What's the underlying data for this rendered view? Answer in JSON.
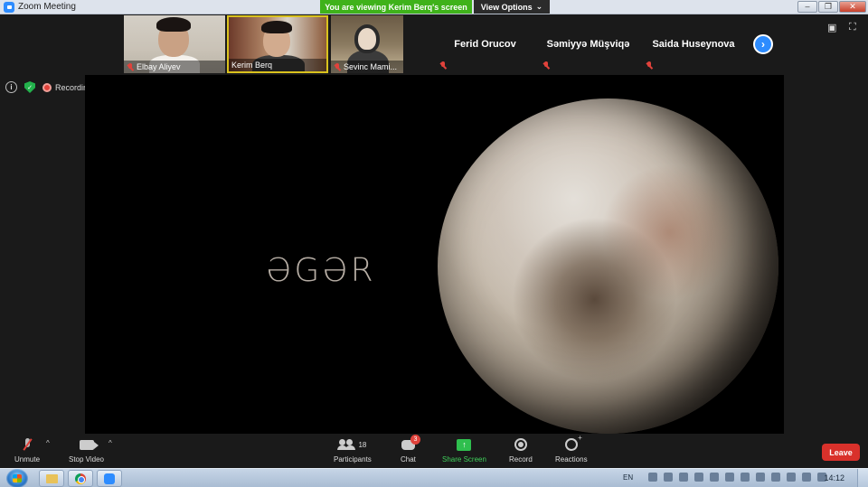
{
  "window": {
    "title": "Zoom Meeting",
    "viewing_banner": "You are viewing Kerim Berq's screen",
    "view_options_label": "View Options",
    "controls": [
      "–",
      "❐",
      "✕"
    ]
  },
  "participants_strip": {
    "video_tiles": [
      {
        "name": "Elbay Aliyev",
        "muted": true
      },
      {
        "name": "Kerim Berq",
        "muted": false
      },
      {
        "name": "Sevinc Mami...",
        "muted": true
      }
    ],
    "name_tiles": [
      {
        "name": "Ferid Orucov",
        "muted": true
      },
      {
        "name": "Səmiyyə Müşviqə",
        "muted": true
      },
      {
        "name": "Saida Huseynova",
        "muted": true
      }
    ],
    "next_arrow": "›"
  },
  "meeting_info": {
    "recording_label": "Recording"
  },
  "shared_screen": {
    "logo_text": "ƏGƏR"
  },
  "toolbar": {
    "unmute_label": "Unmute",
    "stop_video_label": "Stop Video",
    "participants_label": "Participants",
    "participants_count": "18",
    "chat_label": "Chat",
    "chat_badge": "3",
    "share_screen_label": "Share Screen",
    "record_label": "Record",
    "reactions_label": "Reactions",
    "leave_label": "Leave"
  },
  "taskbar": {
    "language": "EN",
    "clock": "14:12"
  },
  "colors": {
    "zoom_blue": "#2d8cff",
    "banner_green": "#3fb21a",
    "leave_red": "#d9312b",
    "share_green": "#2fbf4e"
  }
}
